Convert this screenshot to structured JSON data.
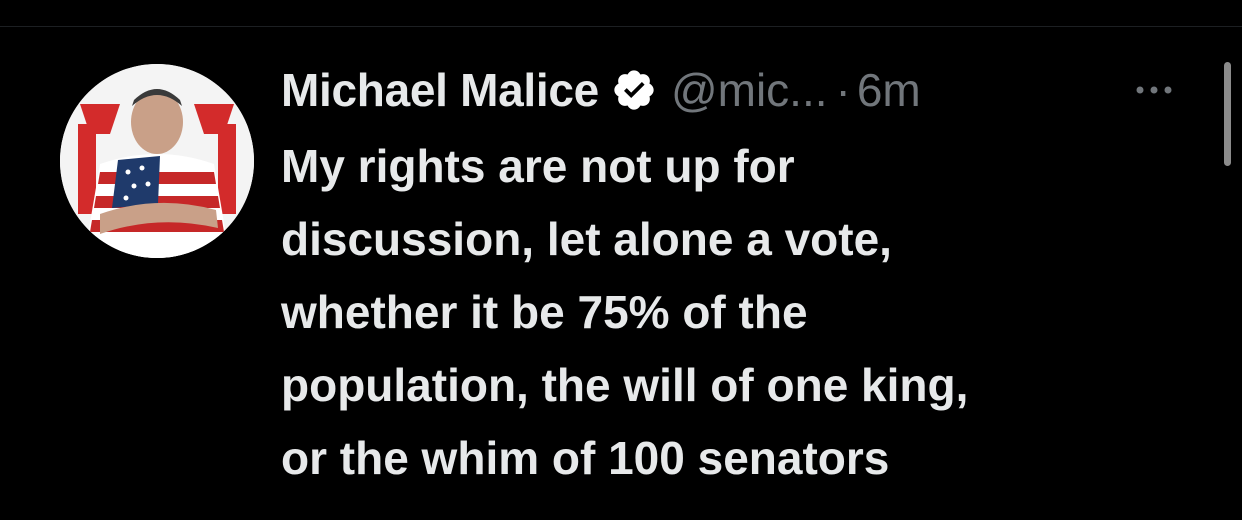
{
  "tweet": {
    "author": {
      "display_name": "Michael Malice",
      "handle": "@mic...",
      "verified": true
    },
    "separator": "·",
    "timestamp": "6m",
    "text_lines": [
      "My rights are not up for",
      "discussion, let alone a vote,",
      "whether it be 75% of the",
      "population, the will of one king,",
      "or the whim of 100 senators"
    ]
  },
  "icons": {
    "verified": "verified-badge-icon",
    "more": "more-options-icon"
  },
  "colors": {
    "background": "#000000",
    "text_primary": "#e7e9ea",
    "text_secondary": "#71767b",
    "verified_badge": "#ffffff"
  }
}
